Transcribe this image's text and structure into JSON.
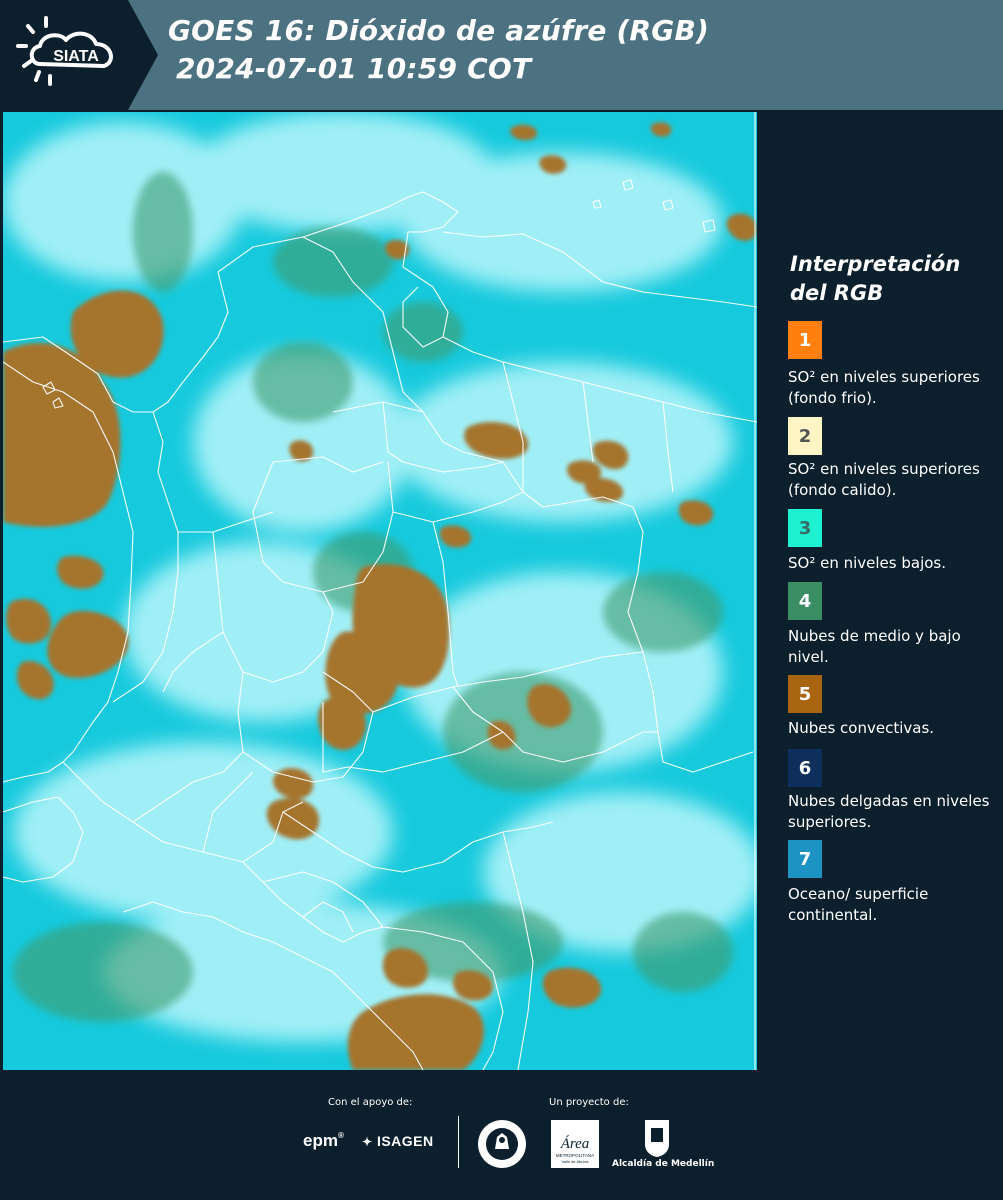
{
  "header": {
    "logo_text": "SIATA",
    "title_line1": "GOES 16: Dióxido de azúfre (RGB)",
    "title_line2": "2024-07-01 10:59 COT"
  },
  "legend": {
    "title_line1": "Interpretación",
    "title_line2": "del RGB",
    "items": [
      {
        "number": "1",
        "color": "#ff7f0f",
        "text_color": "#ffffff",
        "description": "SO² en niveles superiores (fondo frio)."
      },
      {
        "number": "2",
        "color": "#fff5c4",
        "text_color": "#555555",
        "description": "SO² en niveles superiores (fondo calido)."
      },
      {
        "number": "3",
        "color": "#1ef1d0",
        "text_color": "#3a6a6a",
        "description": "SO² en niveles bajos."
      },
      {
        "number": "4",
        "color": "#3a8d62",
        "text_color": "#ffffff",
        "description": "Nubes de medio y bajo nivel."
      },
      {
        "number": "5",
        "color": "#a8640f",
        "text_color": "#ffffff",
        "description": "Nubes convectivas."
      },
      {
        "number": "6",
        "color": "#0e2e5c",
        "text_color": "#ffffff",
        "description": "Nubes delgadas en niveles superiores."
      },
      {
        "number": "7",
        "color": "#1d93c4",
        "text_color": "#ffffff",
        "description": "Oceano/ superficie continental."
      }
    ]
  },
  "map_colors": {
    "background": "#16c9dc",
    "cloud_bright": "#c9fbff",
    "convective": "#a5752e",
    "green_mid": "#3f9b6e",
    "border": "#ffffff"
  },
  "footer": {
    "support_label": "Con el apoyo de:",
    "project_label": "Un proyecto de:",
    "sponsor_epm": "epm",
    "sponsor_isagen": "ISAGEN",
    "area_text": "Área",
    "area_sub1": "METROPOLITANA",
    "area_sub2": "Valle de Aburrá",
    "alcaldia": "Alcaldía de Medellín"
  }
}
